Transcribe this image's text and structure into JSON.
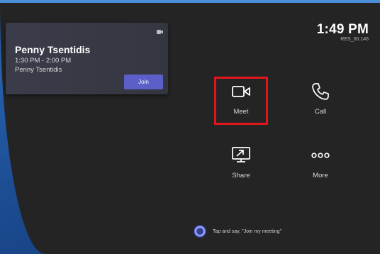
{
  "status": {
    "time": "1:49 PM",
    "device_id": "RES_00.146"
  },
  "meeting_card": {
    "title": "Penny Tsentidis",
    "time_range": "1:30 PM - 2:00 PM",
    "organizer": "Penny Tsentidis",
    "join_label": "Join",
    "icon": "teams-meeting-icon"
  },
  "actions": [
    {
      "label": "Meet",
      "icon": "video-camera-icon",
      "selected": true
    },
    {
      "label": "Call",
      "icon": "phone-icon",
      "selected": false
    },
    {
      "label": "Share",
      "icon": "share-screen-icon",
      "selected": false
    },
    {
      "label": "More",
      "icon": "more-icon",
      "selected": false
    }
  ],
  "voice_hint": {
    "text": "Tap and say, \"Join my meeting\"",
    "icon": "cortana-icon"
  },
  "colors": {
    "background": "#242424",
    "accent": "#5b5fc7",
    "selection": "#e0161b",
    "frame": "#2a6ab8"
  }
}
